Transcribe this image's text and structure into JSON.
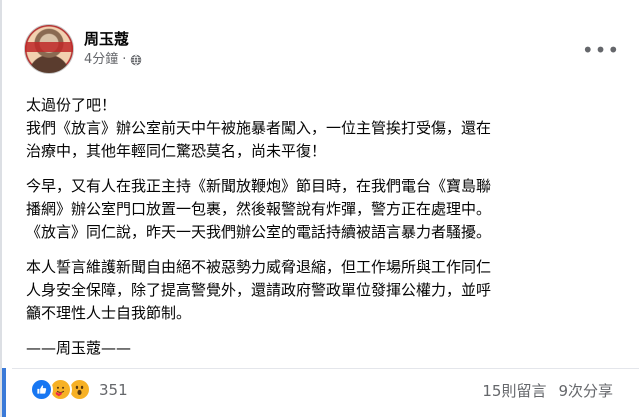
{
  "post": {
    "author": "周玉蔻",
    "time": "4分鐘",
    "dot": "·",
    "privacy_icon": "globe-icon",
    "more_icon": "more-options-icon",
    "paragraphs": [
      "太過份了吧！\n我們《放言》辦公室前天中午被施暴者闖入，一位主管挨打受傷，還在\n治療中，其他年輕同仁驚恐莫名，尚未平復！",
      "今早，又有人在我正主持《新聞放鞭炮》節目時，在我們電台《寶島聯\n播網》辦公室門口放置一包裹，然後報警說有炸彈，警方正在處理中。\n《放言》同仁說，昨天一天我們辦公室的電話持續被語言暴力者騷擾。",
      "本人誓言維護新聞自由絕不被惡勢力威脅退縮，但工作場所與工作同仁\n人身安全保障，除了提高警覺外，還請政府警政單位發揮公權力，並呼\n籲不理性人士自我節制。"
    ],
    "signature": "——周玉蔻——"
  },
  "footer": {
    "reaction_icons": [
      "like-icon",
      "care-icon",
      "wow-icon"
    ],
    "reaction_count": "351",
    "comments": "15則留言",
    "shares": "9次分享"
  },
  "colors": {
    "accent": "#1877f2",
    "secondary_text": "#65676b",
    "left_bar": "#3b7ad8"
  }
}
